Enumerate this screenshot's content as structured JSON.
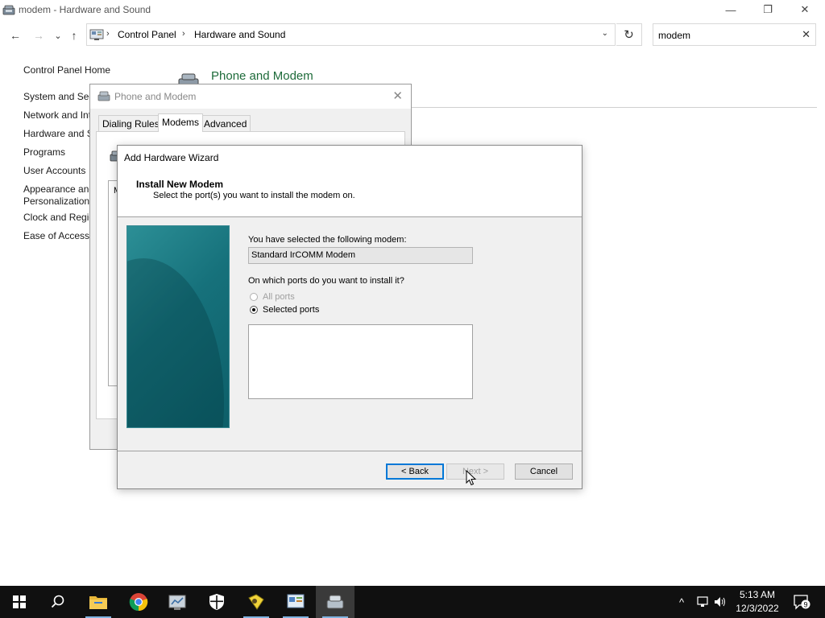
{
  "window": {
    "title": "modem - Hardware and Sound",
    "minimize_glyph": "—",
    "restore_glyph": "❐",
    "close_glyph": "✕"
  },
  "nav": {
    "back_glyph": "←",
    "forward_glyph": "→",
    "recent_glyph": "⌄",
    "up_glyph": "↑",
    "breadcrumb": [
      "Control Panel",
      "Hardware and Sound"
    ],
    "breadcrumb_sep": "›",
    "dropdown_glyph": "⌄",
    "refresh_glyph": "↻",
    "search_value": "modem",
    "search_clear_glyph": "✕"
  },
  "sidebar": {
    "items": [
      "Control Panel Home",
      "System and Sec",
      "Network and Int",
      "Hardware and S",
      "Programs",
      "User Accounts",
      "Appearance and",
      "Personalization",
      "Clock and Regio",
      "Ease of Access"
    ]
  },
  "main": {
    "heading": "Phone and Modem"
  },
  "phone_modem_dialog": {
    "title": "Phone and Modem",
    "close_glyph": "✕",
    "tabs": [
      "Dialing Rules",
      "Modems",
      "Advanced"
    ],
    "active_tab": "Modems",
    "list_letter": "M"
  },
  "wizard": {
    "title": "Add Hardware Wizard",
    "header_title": "Install New Modem",
    "header_subtitle": "Select the port(s) you want to install the modem on.",
    "selected_label": "You have selected the following modem:",
    "modem_name": "Standard IrCOMM Modem",
    "ports_question": "On which ports do you want to install it?",
    "radio_all": "All ports",
    "radio_selected": "Selected ports",
    "selected_option": "Selected ports",
    "back_label": "< Back",
    "next_label": "Next >",
    "cancel_label": "Cancel"
  },
  "taskbar": {
    "apps": [
      "start-icon",
      "search-icon",
      "file-explorer-icon",
      "chrome-icon",
      "server-manager-icon",
      "windows-security-icon",
      "hardware-wizard-icon",
      "control-panel-icon",
      "phone-modem-icon"
    ],
    "time": "5:13 AM",
    "date": "12/3/2022",
    "notification_count": "9",
    "tray_chevron": "^"
  },
  "colors": {
    "heading_green": "#1e6b3a",
    "taskbar": "#101010",
    "accent_blue": "#0078d7",
    "teal_panel": "#16717b"
  }
}
